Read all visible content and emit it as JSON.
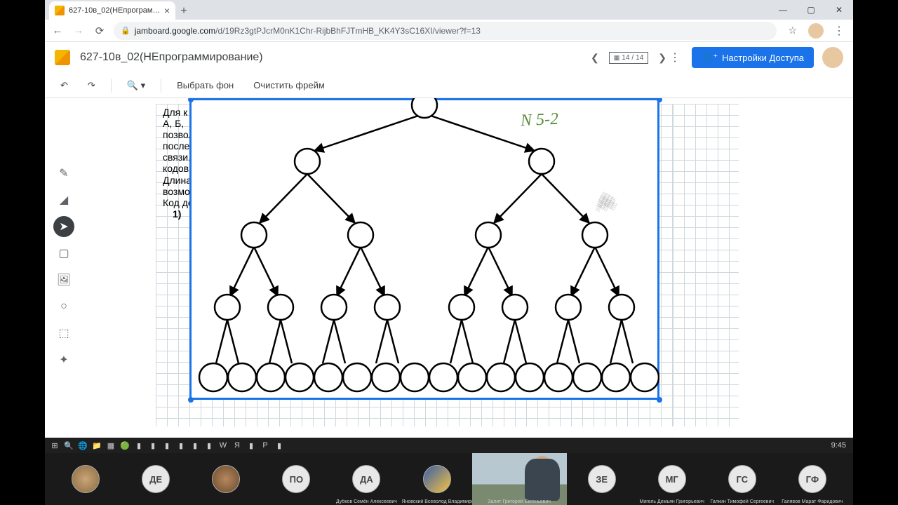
{
  "tab": {
    "title": "627-10в_02(НЕпрограммирован"
  },
  "url": {
    "host": "jamboard.google.com",
    "path": "/d/19Rz3gtPJcrM0nK1Chr-RijbBhFJTmHB_KK4Y3sC16XI/viewer?f=13"
  },
  "doc": {
    "title": "627-10в_02(НЕпрограммирование)"
  },
  "frames": {
    "current": "14",
    "total": "14"
  },
  "header": {
    "share": "Настройки Доступа"
  },
  "toolbar": {
    "background": "Выбрать фон",
    "clear": "Очистить фрейм"
  },
  "problem": {
    "l1": "Для  к",
    "l2": "А, Б,",
    "l3": "позвол",
    "l4": "послед",
    "l5": "связи.",
    "l6": "кодов",
    "l7": "Длина",
    "l8": "возмо",
    "l9": "Код де",
    "l10": "1)"
  },
  "annotation": "N 5‑2",
  "clock": "9:45",
  "participants": [
    {
      "initials": "",
      "name": "",
      "style": "img1"
    },
    {
      "initials": "ДЕ",
      "name": "",
      "style": ""
    },
    {
      "initials": "",
      "name": "",
      "style": "img2"
    },
    {
      "initials": "ПО",
      "name": "",
      "style": ""
    },
    {
      "initials": "ДА",
      "name": "Дубков Семён Алексеевич",
      "style": ""
    },
    {
      "initials": "",
      "name": "Яновский Всеволод Владимирович",
      "style": "img3"
    },
    {
      "initials": "VIDEO",
      "name": "Залит Григорий Евгеньевич",
      "style": "video"
    },
    {
      "initials": "ЗЕ",
      "name": "",
      "style": ""
    },
    {
      "initials": "МГ",
      "name": "Мигель Демьян Григорьевич",
      "style": ""
    },
    {
      "initials": "ГС",
      "name": "Галкин Тимофей Сергеевич",
      "style": ""
    },
    {
      "initials": "ГФ",
      "name": "Галявов Марат Фаридович",
      "style": ""
    }
  ]
}
